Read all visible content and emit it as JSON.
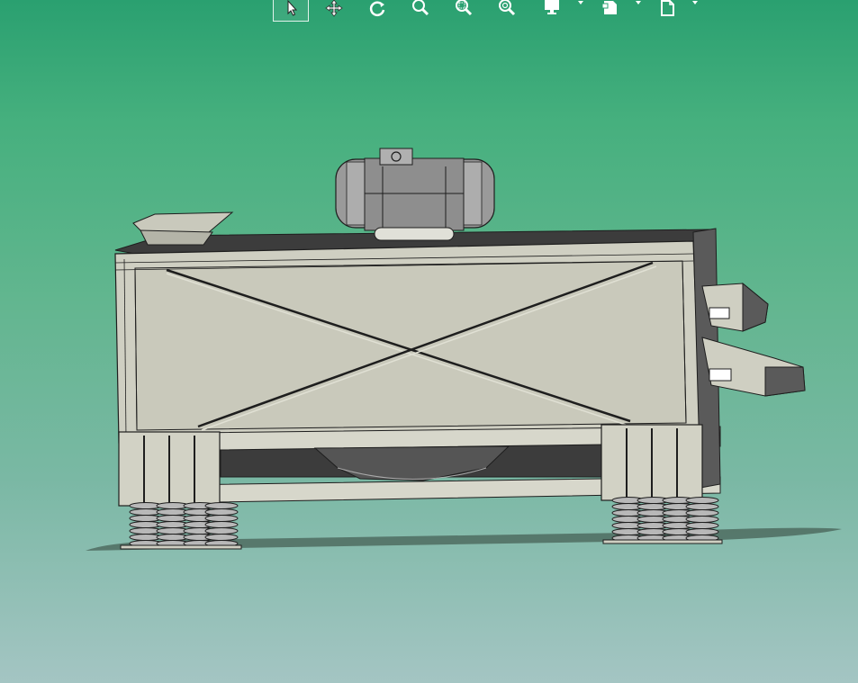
{
  "app": {
    "type": "cad-3d-viewer",
    "background_top": "#2aa070",
    "background_bottom": "#a4c5c3"
  },
  "toolbar": {
    "buttons": [
      {
        "name": "select-button",
        "icon": "pointer-arrow-icon",
        "active": true
      },
      {
        "name": "pan-button",
        "icon": "pan-move-icon",
        "active": false
      },
      {
        "name": "rotate-button",
        "icon": "rotate-icon",
        "active": false
      },
      {
        "name": "zoom-button",
        "icon": "zoom-icon",
        "active": false
      },
      {
        "name": "zoom-area-button",
        "icon": "zoom-area-icon",
        "active": false
      },
      {
        "name": "zoom-fit-button",
        "icon": "zoom-fit-icon",
        "active": false
      },
      {
        "name": "display-mode-button",
        "icon": "monitor-icon",
        "active": false,
        "dropdown": true
      },
      {
        "name": "view-style-button",
        "icon": "view-style-icon",
        "active": false,
        "dropdown": true
      },
      {
        "name": "section-view-button",
        "icon": "document-icon",
        "active": false,
        "dropdown": true
      }
    ]
  },
  "model": {
    "name": "vibrating-screen-assembly",
    "body_color": "#cfcfc2",
    "edge_color": "#1e1e1e",
    "dark_color": "#3f3f3f",
    "spring_color": "#b8b8b8"
  }
}
